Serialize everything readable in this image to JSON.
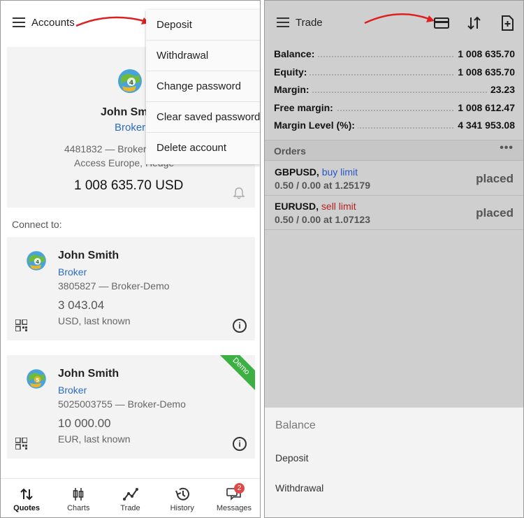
{
  "accounts_screen": {
    "title": "Accounts",
    "menu": [
      "Deposit",
      "Withdrawal",
      "Change password",
      "Clear saved password",
      "Delete account"
    ],
    "current": {
      "name": "John Smith",
      "broker": "Broker",
      "login_line": "4481832 — Broker",
      "server_line": "Access Europe, Hedge",
      "balance": "1 008 635.70 USD"
    },
    "connect_label": "Connect to:",
    "accounts": [
      {
        "name": "John Smith",
        "broker": "Broker",
        "login": "3805827 — Broker-Demo",
        "balance": "3 043.04",
        "currency": "USD, last known",
        "badge": ""
      },
      {
        "name": "John Smith",
        "broker": "Broker",
        "login": "5025003755 — Broker-Demo",
        "balance": "10 000.00",
        "currency": "EUR, last known",
        "badge": "Demo"
      }
    ],
    "nav": [
      "Quotes",
      "Charts",
      "Trade",
      "History",
      "Messages"
    ],
    "messages_badge": "2"
  },
  "trade_screen": {
    "title": "Trade",
    "summary": [
      {
        "label": "Balance:",
        "value": "1 008 635.70"
      },
      {
        "label": "Equity:",
        "value": "1 008 635.70"
      },
      {
        "label": "Margin:",
        "value": "23.23"
      },
      {
        "label": "Free margin:",
        "value": "1 008 612.47"
      },
      {
        "label": "Margin Level (%):",
        "value": "4 341 953.08"
      }
    ],
    "orders_title": "Orders",
    "orders_more": "•••",
    "orders": [
      {
        "symbol": "GBPUSD,",
        "type": "buy limit",
        "detail": "0.50 / 0.00 at 1.25179",
        "status": "placed"
      },
      {
        "symbol": "EURUSD,",
        "type": "sell limit",
        "detail": "0.50 / 0.00 at 1.07123",
        "status": "placed"
      }
    ],
    "sheet": {
      "title": "Balance",
      "items": [
        "Deposit",
        "Withdrawal"
      ]
    }
  },
  "colors": {
    "link_blue": "#2a6bc8",
    "buy_blue": "#2a55c8",
    "sell_red": "#b22222",
    "demo_green": "#3cb043",
    "badge_red": "#e04848",
    "arrow_red": "#e02020"
  }
}
